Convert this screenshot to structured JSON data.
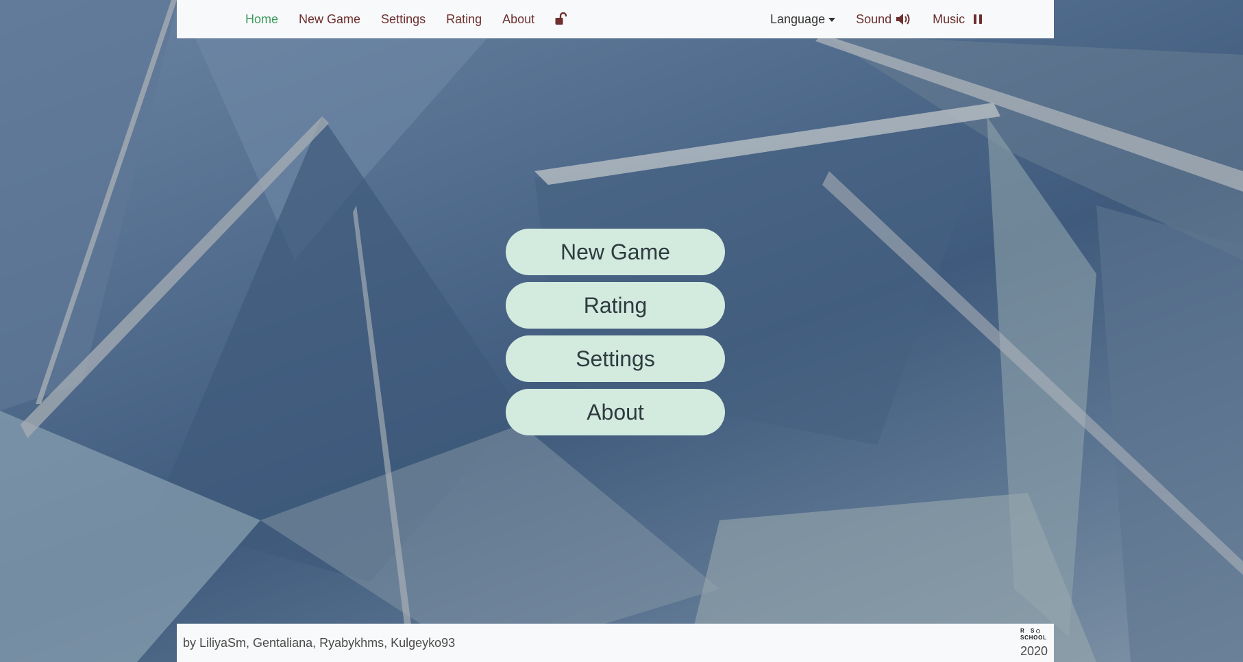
{
  "nav": {
    "home": "Home",
    "new_game": "New Game",
    "settings": "Settings",
    "rating": "Rating",
    "about": "About",
    "language": "Language",
    "sound": "Sound",
    "music": "Music",
    "active_item": "Home",
    "colors": {
      "link": "#6d2f2f",
      "active": "#3d9a5c"
    },
    "icons": [
      "unlock-icon",
      "speaker-icon",
      "pause-icon",
      "caret-down-icon"
    ]
  },
  "menu": {
    "items": [
      "New Game",
      "Rating",
      "Settings",
      "About"
    ],
    "button_color": "#d3eadf"
  },
  "footer": {
    "authors": "by LiliyaSm, Gentaliana, Ryabykhms, Kulgeyko93",
    "logo_text": "RS SCHOOL",
    "year": "2020"
  }
}
